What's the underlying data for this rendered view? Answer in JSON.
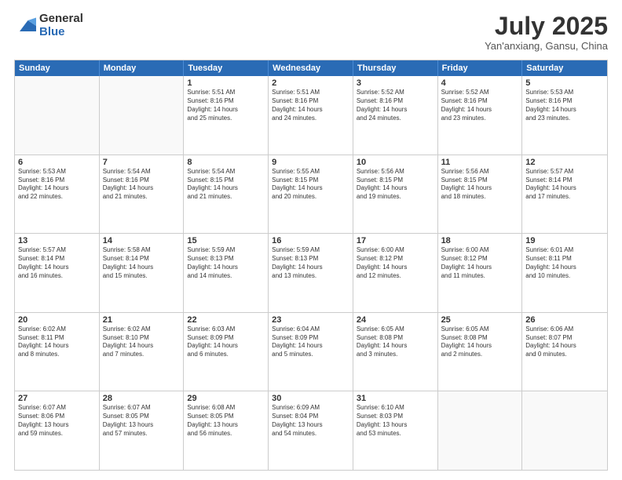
{
  "logo": {
    "general": "General",
    "blue": "Blue"
  },
  "header": {
    "month": "July 2025",
    "location": "Yan'anxiang, Gansu, China"
  },
  "days": [
    "Sunday",
    "Monday",
    "Tuesday",
    "Wednesday",
    "Thursday",
    "Friday",
    "Saturday"
  ],
  "weeks": [
    [
      {
        "day": "",
        "empty": true
      },
      {
        "day": "",
        "empty": true
      },
      {
        "day": "1",
        "line1": "Sunrise: 5:51 AM",
        "line2": "Sunset: 8:16 PM",
        "line3": "Daylight: 14 hours",
        "line4": "and 25 minutes."
      },
      {
        "day": "2",
        "line1": "Sunrise: 5:51 AM",
        "line2": "Sunset: 8:16 PM",
        "line3": "Daylight: 14 hours",
        "line4": "and 24 minutes."
      },
      {
        "day": "3",
        "line1": "Sunrise: 5:52 AM",
        "line2": "Sunset: 8:16 PM",
        "line3": "Daylight: 14 hours",
        "line4": "and 24 minutes."
      },
      {
        "day": "4",
        "line1": "Sunrise: 5:52 AM",
        "line2": "Sunset: 8:16 PM",
        "line3": "Daylight: 14 hours",
        "line4": "and 23 minutes."
      },
      {
        "day": "5",
        "line1": "Sunrise: 5:53 AM",
        "line2": "Sunset: 8:16 PM",
        "line3": "Daylight: 14 hours",
        "line4": "and 23 minutes."
      }
    ],
    [
      {
        "day": "6",
        "line1": "Sunrise: 5:53 AM",
        "line2": "Sunset: 8:16 PM",
        "line3": "Daylight: 14 hours",
        "line4": "and 22 minutes."
      },
      {
        "day": "7",
        "line1": "Sunrise: 5:54 AM",
        "line2": "Sunset: 8:16 PM",
        "line3": "Daylight: 14 hours",
        "line4": "and 21 minutes."
      },
      {
        "day": "8",
        "line1": "Sunrise: 5:54 AM",
        "line2": "Sunset: 8:15 PM",
        "line3": "Daylight: 14 hours",
        "line4": "and 21 minutes."
      },
      {
        "day": "9",
        "line1": "Sunrise: 5:55 AM",
        "line2": "Sunset: 8:15 PM",
        "line3": "Daylight: 14 hours",
        "line4": "and 20 minutes."
      },
      {
        "day": "10",
        "line1": "Sunrise: 5:56 AM",
        "line2": "Sunset: 8:15 PM",
        "line3": "Daylight: 14 hours",
        "line4": "and 19 minutes."
      },
      {
        "day": "11",
        "line1": "Sunrise: 5:56 AM",
        "line2": "Sunset: 8:15 PM",
        "line3": "Daylight: 14 hours",
        "line4": "and 18 minutes."
      },
      {
        "day": "12",
        "line1": "Sunrise: 5:57 AM",
        "line2": "Sunset: 8:14 PM",
        "line3": "Daylight: 14 hours",
        "line4": "and 17 minutes."
      }
    ],
    [
      {
        "day": "13",
        "line1": "Sunrise: 5:57 AM",
        "line2": "Sunset: 8:14 PM",
        "line3": "Daylight: 14 hours",
        "line4": "and 16 minutes."
      },
      {
        "day": "14",
        "line1": "Sunrise: 5:58 AM",
        "line2": "Sunset: 8:14 PM",
        "line3": "Daylight: 14 hours",
        "line4": "and 15 minutes."
      },
      {
        "day": "15",
        "line1": "Sunrise: 5:59 AM",
        "line2": "Sunset: 8:13 PM",
        "line3": "Daylight: 14 hours",
        "line4": "and 14 minutes."
      },
      {
        "day": "16",
        "line1": "Sunrise: 5:59 AM",
        "line2": "Sunset: 8:13 PM",
        "line3": "Daylight: 14 hours",
        "line4": "and 13 minutes."
      },
      {
        "day": "17",
        "line1": "Sunrise: 6:00 AM",
        "line2": "Sunset: 8:12 PM",
        "line3": "Daylight: 14 hours",
        "line4": "and 12 minutes."
      },
      {
        "day": "18",
        "line1": "Sunrise: 6:00 AM",
        "line2": "Sunset: 8:12 PM",
        "line3": "Daylight: 14 hours",
        "line4": "and 11 minutes."
      },
      {
        "day": "19",
        "line1": "Sunrise: 6:01 AM",
        "line2": "Sunset: 8:11 PM",
        "line3": "Daylight: 14 hours",
        "line4": "and 10 minutes."
      }
    ],
    [
      {
        "day": "20",
        "line1": "Sunrise: 6:02 AM",
        "line2": "Sunset: 8:11 PM",
        "line3": "Daylight: 14 hours",
        "line4": "and 8 minutes."
      },
      {
        "day": "21",
        "line1": "Sunrise: 6:02 AM",
        "line2": "Sunset: 8:10 PM",
        "line3": "Daylight: 14 hours",
        "line4": "and 7 minutes."
      },
      {
        "day": "22",
        "line1": "Sunrise: 6:03 AM",
        "line2": "Sunset: 8:09 PM",
        "line3": "Daylight: 14 hours",
        "line4": "and 6 minutes."
      },
      {
        "day": "23",
        "line1": "Sunrise: 6:04 AM",
        "line2": "Sunset: 8:09 PM",
        "line3": "Daylight: 14 hours",
        "line4": "and 5 minutes."
      },
      {
        "day": "24",
        "line1": "Sunrise: 6:05 AM",
        "line2": "Sunset: 8:08 PM",
        "line3": "Daylight: 14 hours",
        "line4": "and 3 minutes."
      },
      {
        "day": "25",
        "line1": "Sunrise: 6:05 AM",
        "line2": "Sunset: 8:08 PM",
        "line3": "Daylight: 14 hours",
        "line4": "and 2 minutes."
      },
      {
        "day": "26",
        "line1": "Sunrise: 6:06 AM",
        "line2": "Sunset: 8:07 PM",
        "line3": "Daylight: 14 hours",
        "line4": "and 0 minutes."
      }
    ],
    [
      {
        "day": "27",
        "line1": "Sunrise: 6:07 AM",
        "line2": "Sunset: 8:06 PM",
        "line3": "Daylight: 13 hours",
        "line4": "and 59 minutes."
      },
      {
        "day": "28",
        "line1": "Sunrise: 6:07 AM",
        "line2": "Sunset: 8:05 PM",
        "line3": "Daylight: 13 hours",
        "line4": "and 57 minutes."
      },
      {
        "day": "29",
        "line1": "Sunrise: 6:08 AM",
        "line2": "Sunset: 8:05 PM",
        "line3": "Daylight: 13 hours",
        "line4": "and 56 minutes."
      },
      {
        "day": "30",
        "line1": "Sunrise: 6:09 AM",
        "line2": "Sunset: 8:04 PM",
        "line3": "Daylight: 13 hours",
        "line4": "and 54 minutes."
      },
      {
        "day": "31",
        "line1": "Sunrise: 6:10 AM",
        "line2": "Sunset: 8:03 PM",
        "line3": "Daylight: 13 hours",
        "line4": "and 53 minutes."
      },
      {
        "day": "",
        "empty": true
      },
      {
        "day": "",
        "empty": true
      }
    ]
  ]
}
